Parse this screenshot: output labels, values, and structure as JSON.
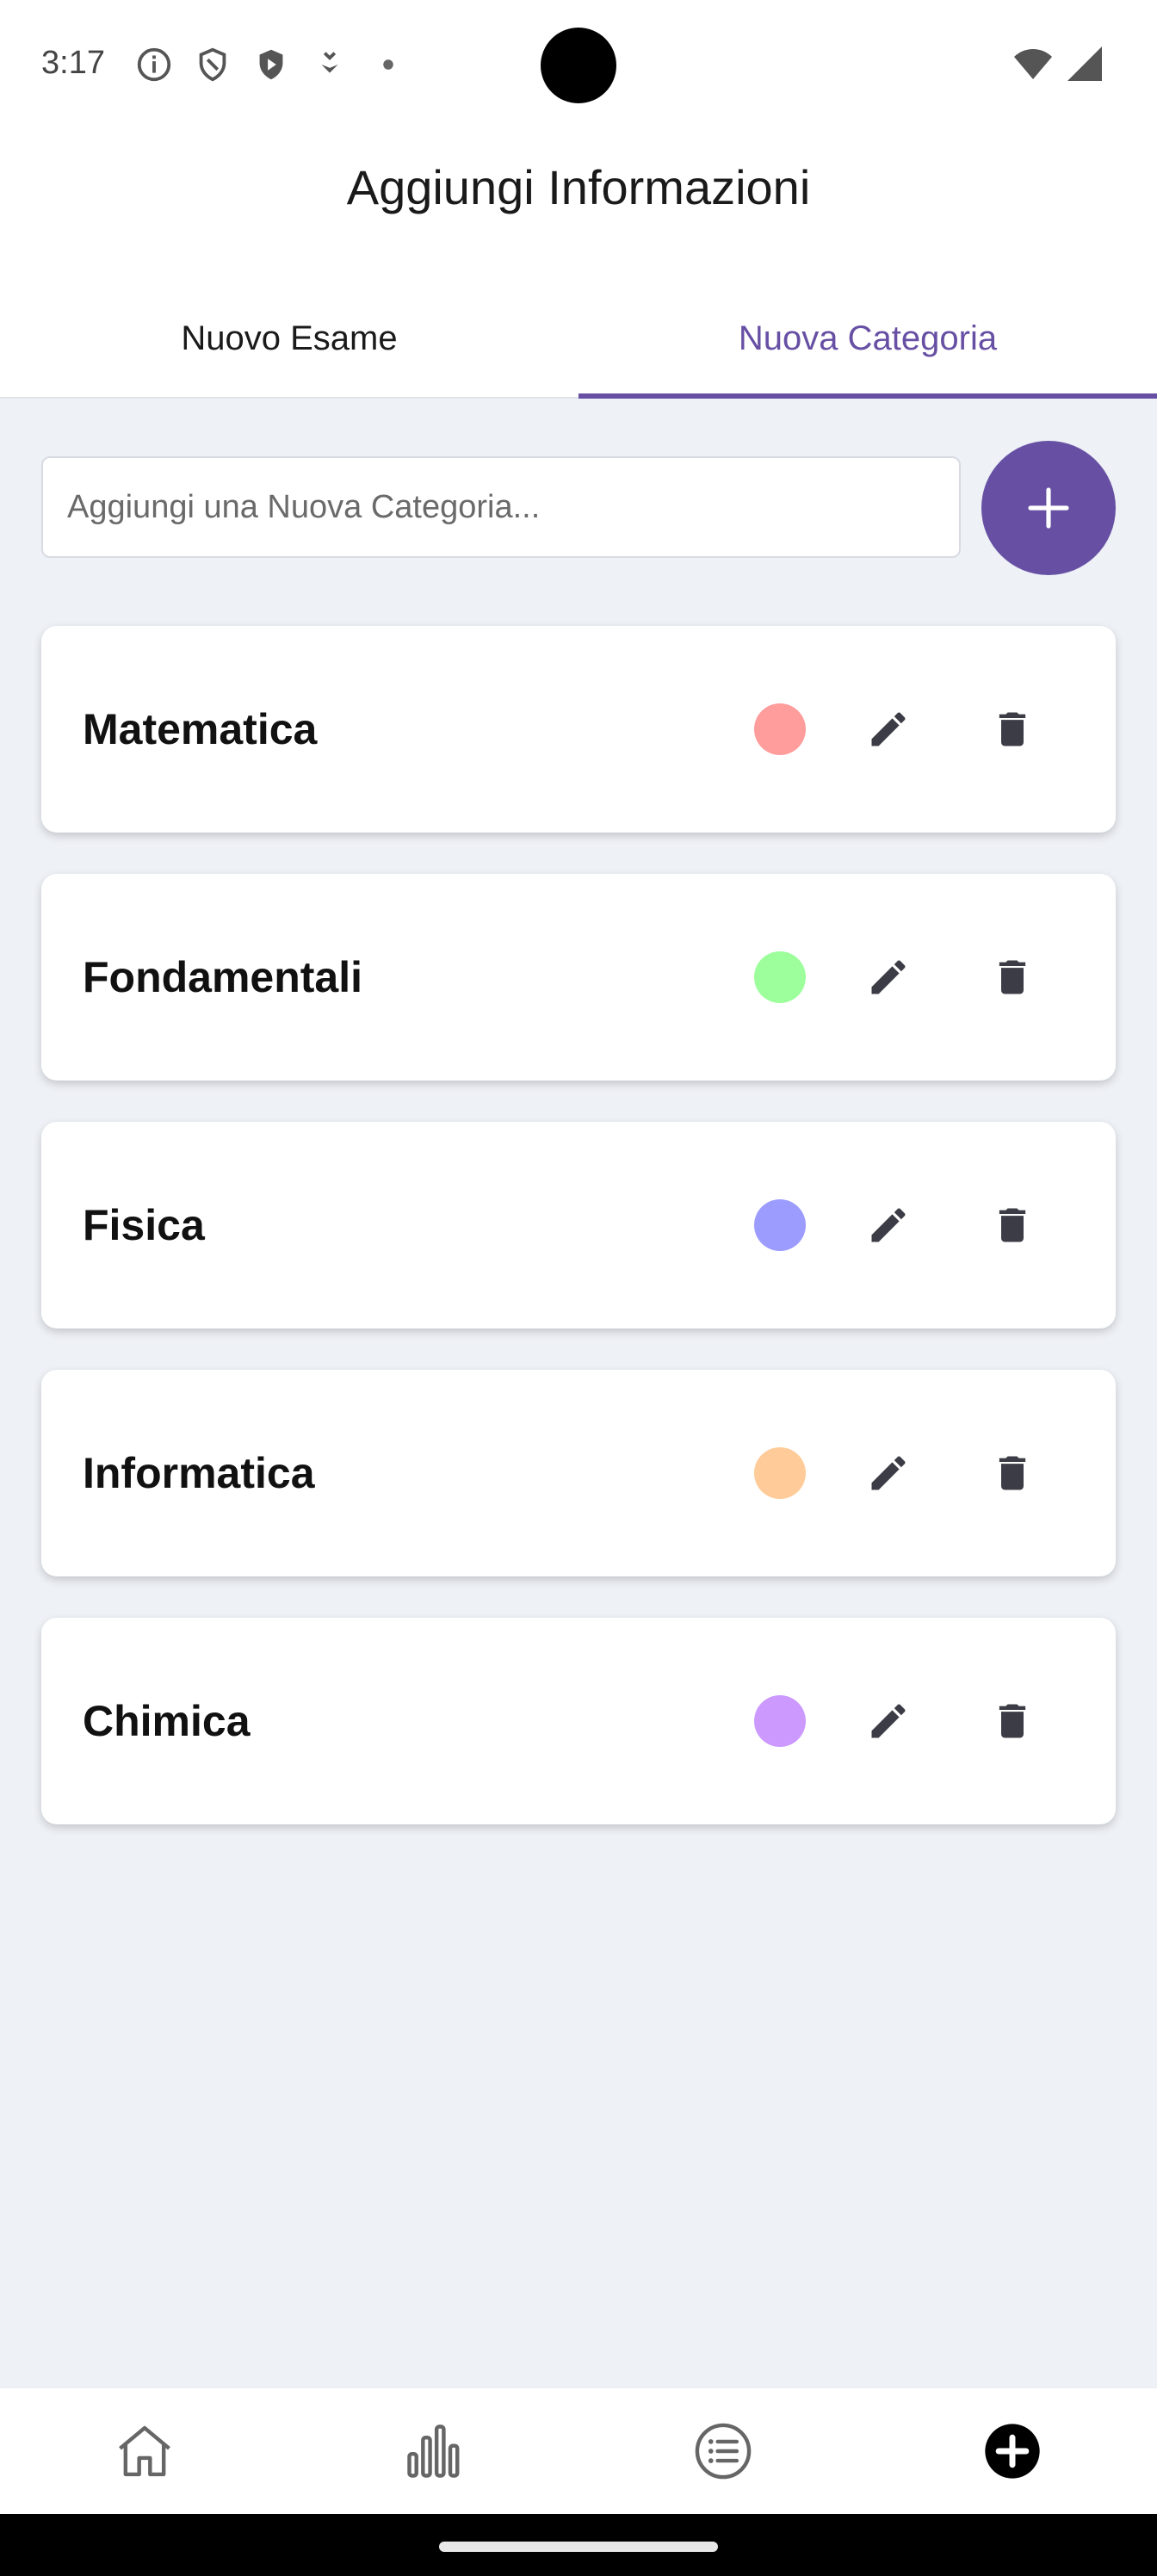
{
  "status_bar": {
    "time": "3:17",
    "left_icons": [
      "info-icon",
      "shield-icon",
      "play-shield-icon",
      "download-icon",
      "dot-icon"
    ],
    "right_icons": [
      "wifi-icon",
      "signal-icon"
    ]
  },
  "header": {
    "title": "Aggiungi Informazioni"
  },
  "tabs": [
    {
      "label": "Nuovo Esame",
      "active": false
    },
    {
      "label": "Nuova Categoria",
      "active": true
    }
  ],
  "add_category": {
    "placeholder": "Aggiungi una Nuova Categoria...",
    "value": "",
    "button_icon": "plus-icon"
  },
  "categories": [
    {
      "name": "Matematica",
      "color": "#ff9c9c"
    },
    {
      "name": "Fondamentali",
      "color": "#9cff9c"
    },
    {
      "name": "Fisica",
      "color": "#9c9cff"
    },
    {
      "name": "Informatica",
      "color": "#ffcc99"
    },
    {
      "name": "Chimica",
      "color": "#cc99ff"
    }
  ],
  "bottom_nav": [
    {
      "icon": "home-icon",
      "active": false
    },
    {
      "icon": "bar-chart-icon",
      "active": false
    },
    {
      "icon": "list-icon",
      "active": false
    },
    {
      "icon": "add-circle-icon",
      "active": true
    }
  ],
  "colors": {
    "accent": "#6750a4",
    "background": "#eef1f6"
  }
}
